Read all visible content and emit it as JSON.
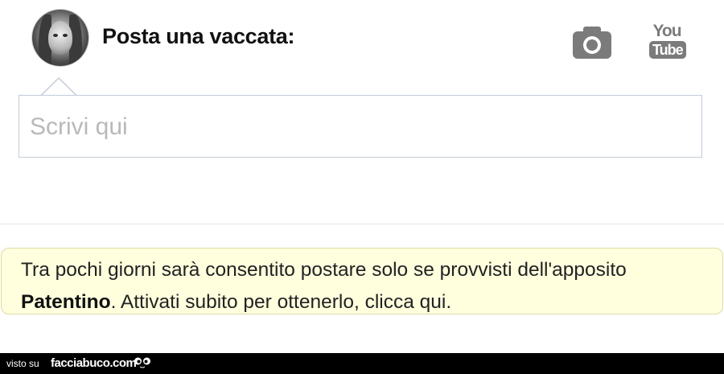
{
  "header": {
    "title": "Posta una vaccata:",
    "icons": [
      "avatar",
      "camera-icon",
      "youtube-icon"
    ]
  },
  "youtube_logo": {
    "top": "You",
    "bottom": "Tube"
  },
  "composer": {
    "placeholder": "Scrivi qui"
  },
  "notice": {
    "text_before": "Tra pochi giorni sarà consentito postare solo se provvisti dell'apposito ",
    "bold": "Patentino",
    "text_after": ". Attivati subito per ottenerlo, clicca qui."
  },
  "footer": {
    "prefix": "visto su",
    "brand": "facciabuco.com"
  },
  "colors": {
    "notice_bg": "#ffffde",
    "notice_border": "#dcdca8",
    "input_border": "#c4ccd8",
    "icon_gray": "#7b7b7b"
  }
}
